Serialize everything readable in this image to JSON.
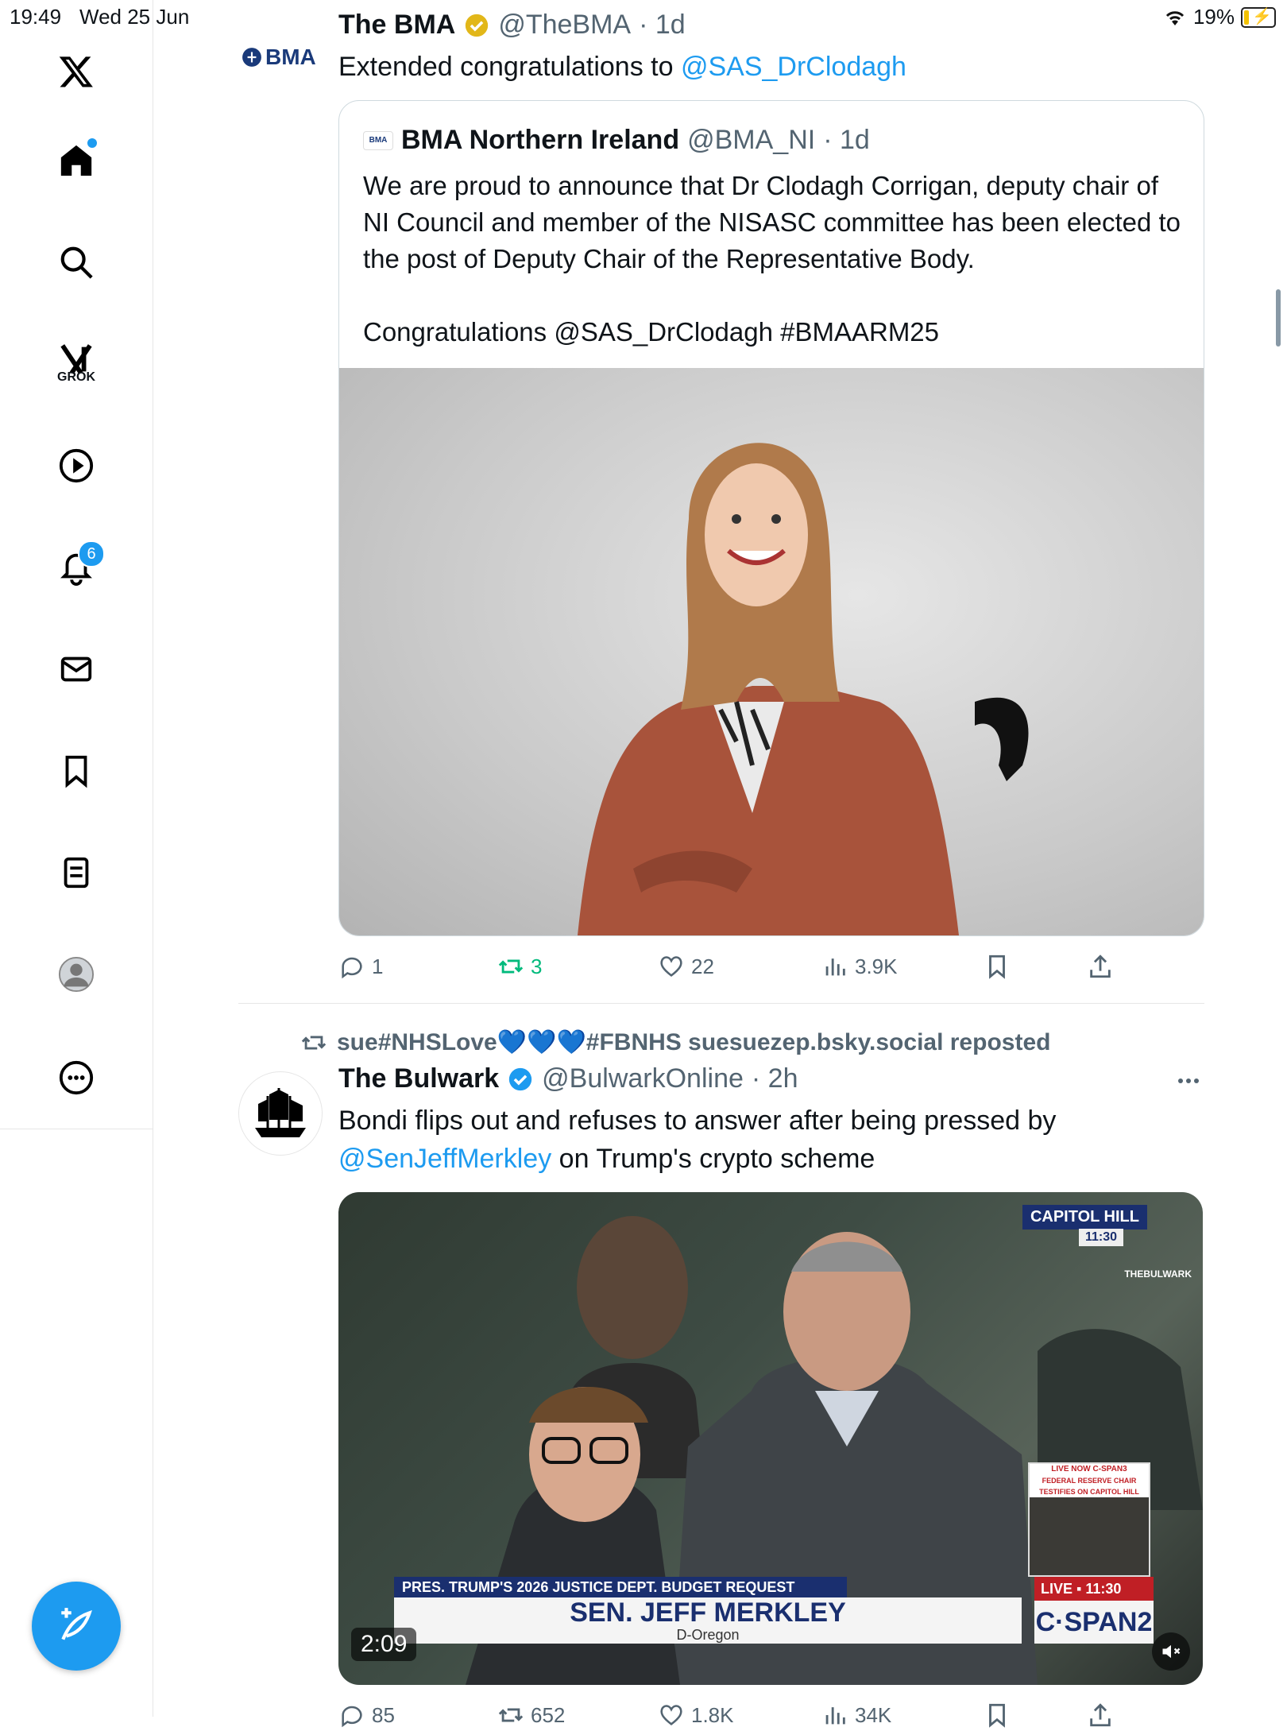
{
  "status_bar": {
    "time": "19:49",
    "date": "Wed 25 Jun",
    "battery": "19%",
    "battery_level": 0.19
  },
  "sidebar": {
    "grok_label": "GROK",
    "notifications_count": "6"
  },
  "tweet1": {
    "author_name": "The BMA",
    "handle": "@TheBMA",
    "time": "· 1d",
    "avatar_text": "BMA",
    "text_prefix": "Extended congratulations to ",
    "mention": "@SAS_DrClodagh",
    "quote": {
      "author_name": "BMA Northern Ireland",
      "handle": "@BMA_NI",
      "time": "· 1d",
      "avatar_text": "BMA",
      "paragraph1": "We are proud to announce that Dr Clodagh Corrigan, deputy chair of NI Council and member of the NISASC committee has been elected to the post of Deputy Chair of the Representative Body.",
      "paragraph2": "Congratulations @SAS_DrClodagh #BMAARM25"
    },
    "actions": {
      "replies": "1",
      "reposts": "3",
      "likes": "22",
      "views": "3.9K"
    }
  },
  "tweet2": {
    "repost_by": "sue#NHSLove💙💙💙#FBNHS suesuezep.bsky.social reposted",
    "author_name": "The Bulwark",
    "handle": "@BulwarkOnline",
    "time": "· 2h",
    "text_line1": "Bondi flips out and refuses to answer after being pressed by",
    "mention": "@SenJeffMerkley",
    "text_line2_rest": " on Trump's crypto scheme",
    "video": {
      "capitol": "CAPITOL HILL",
      "capitol_time": "11:30",
      "watermark": "THEBULWARK",
      "lower_third_top": "PRES. TRUMP'S 2026 JUSTICE DEPT. BUDGET REQUEST",
      "lower_third_name": "SEN. JEFF MERKLEY",
      "lower_third_sub": "D-Oregon",
      "live": "LIVE ▪ 11:30",
      "network": "C·SPAN2",
      "inset_top": "LIVE NOW C-SPAN3",
      "inset_sub": "FEDERAL RESERVE CHAIR TESTIFIES ON CAPITOL HILL",
      "duration": "2:09"
    },
    "actions": {
      "replies": "85",
      "reposts": "652",
      "likes": "1.8K",
      "views": "34K"
    }
  }
}
